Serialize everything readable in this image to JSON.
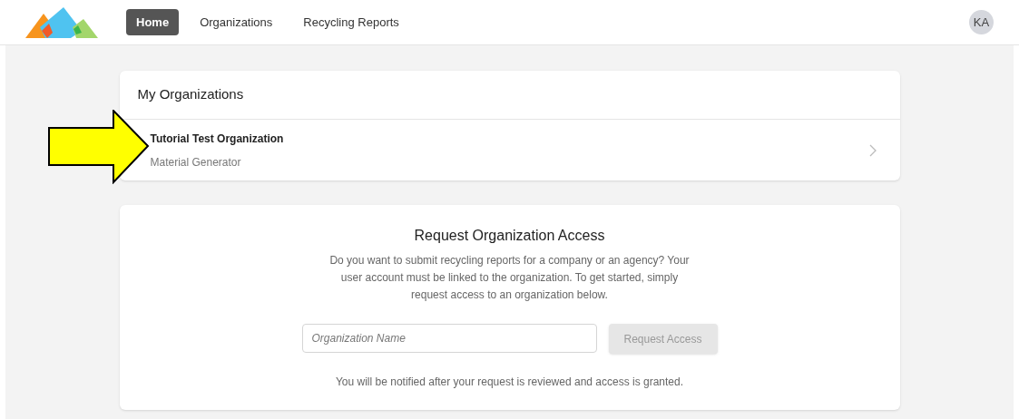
{
  "nav": {
    "tabs": [
      {
        "label": "Home",
        "selected": true
      },
      {
        "label": "Organizations",
        "selected": false
      },
      {
        "label": "Recycling Reports",
        "selected": false
      }
    ],
    "avatar": "KA"
  },
  "my_organizations": {
    "title": "My Organizations",
    "items": [
      {
        "name": "Tutorial Test Organization",
        "role": "Material Generator"
      }
    ]
  },
  "request_access": {
    "title": "Request Organization Access",
    "description": "Do you want to submit recycling reports for a company or an agency? Your user account must be linked to the organization. To get started, simply request access to an organization below.",
    "field": {
      "placeholder": "Organization Name"
    },
    "button": {
      "label": "Request Access",
      "disabled": true
    },
    "note": "You will be notified after your request is reviewed and access is granted."
  }
}
